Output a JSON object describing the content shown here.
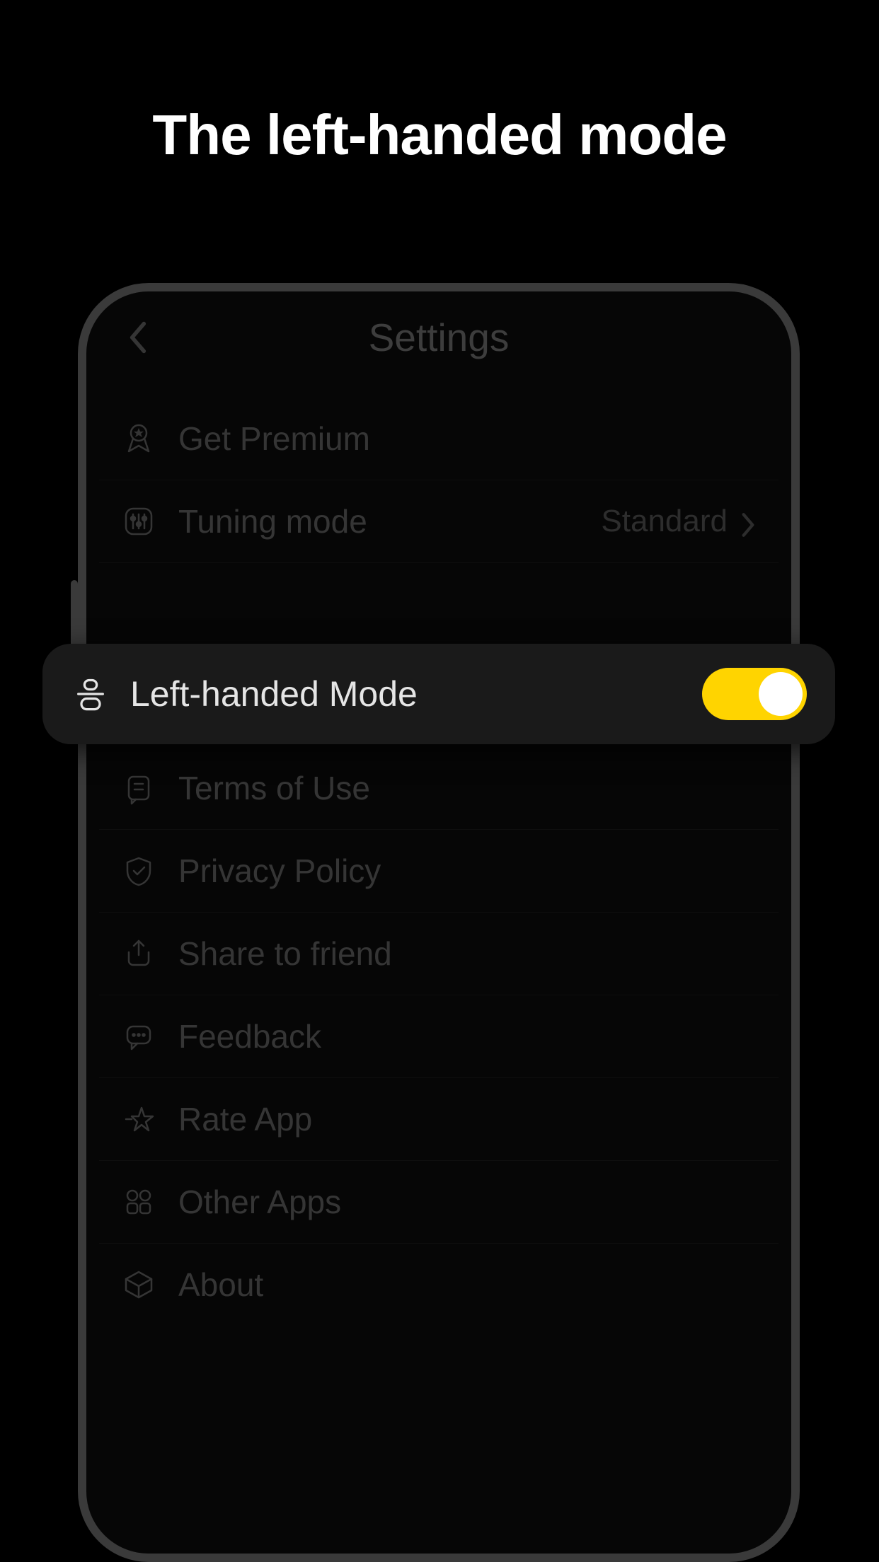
{
  "promo": {
    "title": "The left-handed mode"
  },
  "header": {
    "title": "Settings"
  },
  "rows": {
    "premium": {
      "label": "Get Premium"
    },
    "tuning": {
      "label": "Tuning mode",
      "value": "Standard"
    },
    "lefthanded": {
      "label": "Left-handed Mode",
      "toggle_on": true
    },
    "terms": {
      "label": "Terms of Use"
    },
    "privacy": {
      "label": "Privacy Policy"
    },
    "share": {
      "label": "Share to friend"
    },
    "feedback": {
      "label": "Feedback"
    },
    "rate": {
      "label": "Rate App"
    },
    "other": {
      "label": "Other Apps"
    },
    "about": {
      "label": "About"
    }
  },
  "colors": {
    "accent": "#ffd400",
    "bg": "#000000",
    "panel": "#1a1a1a",
    "text_dim": "#6a6a6a",
    "text_bright": "#e5e5e5"
  }
}
